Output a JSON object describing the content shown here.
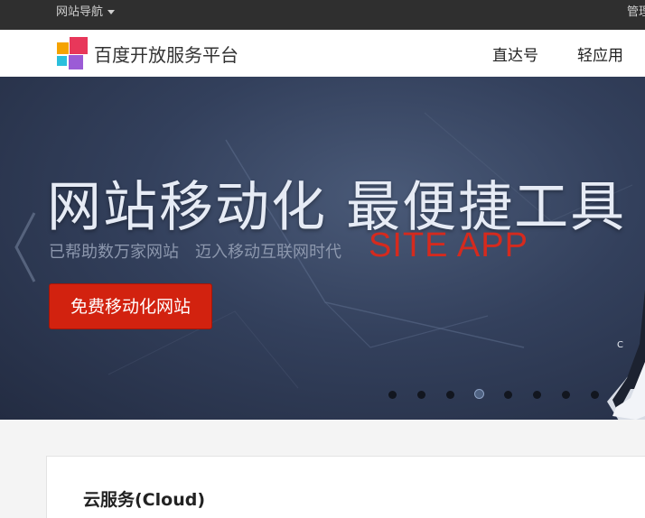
{
  "topbar": {
    "nav_label": "网站导航",
    "manage_label": "管理"
  },
  "header": {
    "brand": "百度开放服务平台",
    "menu": [
      "直达号",
      "轻应用"
    ]
  },
  "banner": {
    "headline": "网站移动化 最便捷工具",
    "sub_part1": "已帮助数万家网站",
    "sub_part2": "迈入移动互联网时代",
    "site_app": "SITE APP",
    "cta_label": "免费移动化网站",
    "slide_count": 8,
    "active_slide": 4
  },
  "content": {
    "section_title": "云服务(Cloud)"
  },
  "colors": {
    "topbar_bg": "#2f2f2f",
    "banner_bg": "#33405c",
    "accent_red": "#d2220f",
    "site_app_red": "#d52a1e"
  },
  "icons": {
    "logo": "baidu-open-logo",
    "nav_caret": "caret-down-icon",
    "slider_prev": "chevron-left-icon"
  }
}
